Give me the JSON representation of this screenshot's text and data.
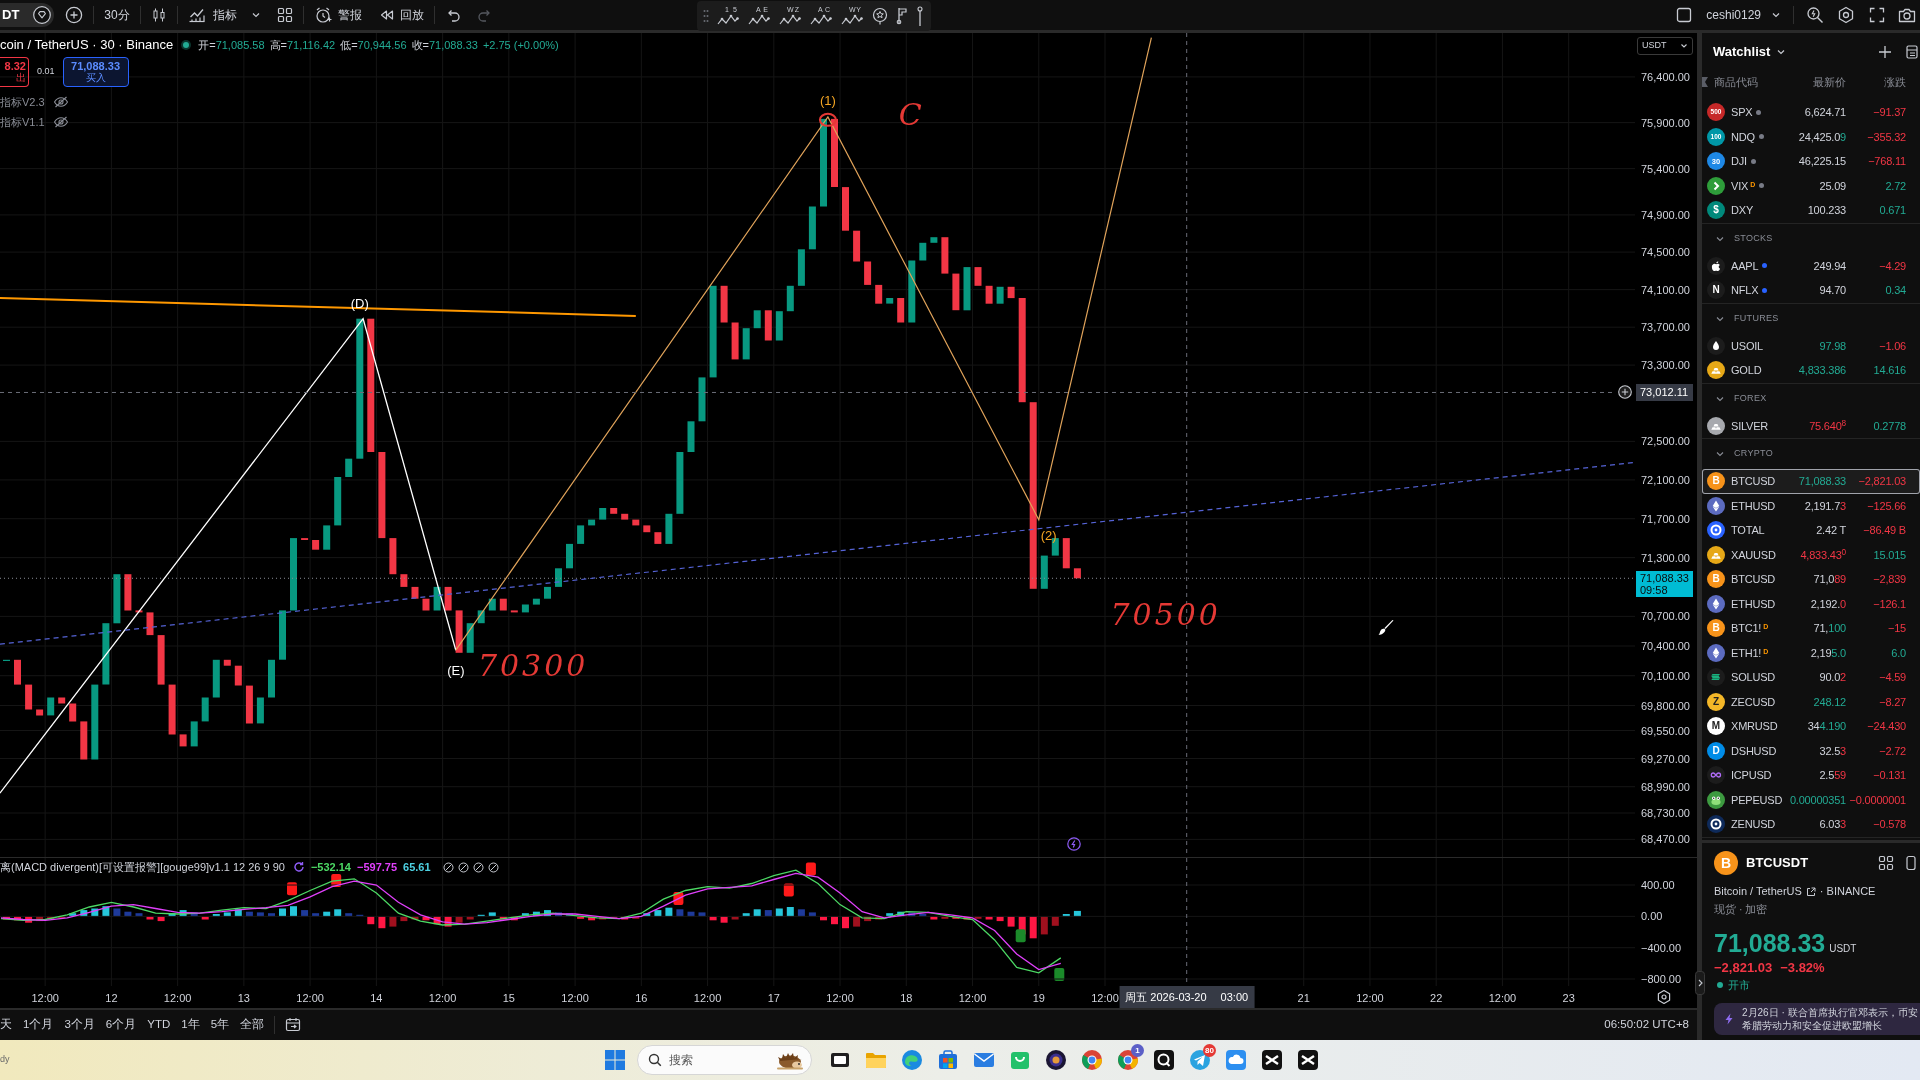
{
  "toolbar": {
    "symbol": "DT",
    "interval": "30分",
    "indicators": "指标",
    "alerts": "警报",
    "replay": "回放",
    "wave_tools": [
      {
        "marks": [
          "1",
          "5"
        ]
      },
      {
        "marks": [
          "A",
          "E"
        ]
      },
      {
        "marks": [
          "W",
          "Z"
        ]
      },
      {
        "marks": [
          "A",
          "C"
        ]
      },
      {
        "marks": [
          "W",
          "Y"
        ]
      }
    ],
    "user": "ceshi0129"
  },
  "legend": {
    "title": "coin / TetherUS · 30 · Binance",
    "market_open": true,
    "ohlc": [
      {
        "label": "开=",
        "value": "71,085.58"
      },
      {
        "label": "高=",
        "value": "71,116.42"
      },
      {
        "label": "低=",
        "value": "70,944.56"
      },
      {
        "label": "收=",
        "value": "71,088.33"
      }
    ],
    "change": "+2.75 (+0.00%)"
  },
  "order_panel": {
    "sell_price": "8.32",
    "sell_label": "出",
    "spread": "0.01",
    "buy_price": "71,088.33",
    "buy_label": "买入"
  },
  "indicators": [
    {
      "name": "指标V2.3",
      "hidden": true
    },
    {
      "name": "指标V1.1",
      "hidden": true
    }
  ],
  "chart": {
    "wave_labels": [
      {
        "text": "(1)",
        "color": "#f5a623"
      },
      {
        "text": "(D)",
        "color": "#ffffff"
      },
      {
        "text": "(E)",
        "color": "#ffffff"
      },
      {
        "text": "(2)",
        "color": "#f5a623"
      }
    ],
    "notes": [
      {
        "text": "C"
      },
      {
        "text": "70300"
      },
      {
        "text": "70500"
      }
    ]
  },
  "price_axis": {
    "currency": "USDT",
    "labels": [
      "76,400.00",
      "75,900.00",
      "75,400.00",
      "74,900.00",
      "74,500.00",
      "74,100.00",
      "73,700.00",
      "73,300.00",
      "72,500.00",
      "72,100.00",
      "71,700.00",
      "71,300.00",
      "70,700.00",
      "70,400.00",
      "70,100.00",
      "69,800.00",
      "69,550.00",
      "69,270.00",
      "68,990.00",
      "68,730.00",
      "68,470.00"
    ],
    "crosshair_price": "73,012.11",
    "last_price": "71,088.33",
    "countdown": "09:58"
  },
  "macd": {
    "title": "离(MACD divergent)[可设置报警][gouge99]v1.1 12 26 9 90",
    "values": [
      {
        "text": "−532.14",
        "color": "#4cd964"
      },
      {
        "text": "−597.75",
        "color": "#e040fb"
      },
      {
        "text": "65.61",
        "color": "#4dd0e1"
      }
    ],
    "chart_data": {
      "type": "line",
      "categories": [
        null,
        null,
        "12:00",
        null,
        null,
        "12",
        null,
        null,
        "12:00",
        null,
        null,
        "13",
        null,
        null,
        "12:00",
        null,
        null,
        "14",
        null,
        null,
        "12:00",
        null,
        null,
        "15",
        null,
        null,
        "12:00",
        null,
        null,
        "16",
        null,
        null,
        "12:00",
        null,
        null,
        "17",
        null,
        null,
        "12:00",
        null,
        null,
        "18",
        null,
        null,
        "12:00",
        null,
        null,
        "19",
        null,
        null,
        "12:00",
        null,
        null,
        null,
        null,
        null,
        null,
        null,
        null,
        "21",
        null,
        null,
        "12:00",
        null,
        null,
        "22",
        null,
        null,
        "12:00",
        null,
        null,
        "23"
      ],
      "series": [
        {
          "color": "#4cd964",
          "values": [
            -30,
            -50,
            -40,
            20,
            120,
            180,
            120,
            40,
            30,
            40,
            80,
            110,
            100,
            200,
            330,
            450,
            480,
            300,
            40,
            -60,
            -110,
            -100,
            -60,
            -20,
            20,
            40,
            10,
            -20,
            -30,
            40,
            220,
            330,
            380,
            360,
            420,
            520,
            590,
            420,
            150,
            -20,
            -30,
            60,
            50,
            0,
            -40,
            -300,
            -650,
            -720,
            -530,
            null,
            null,
            null,
            null,
            null,
            null,
            null,
            null,
            null,
            null,
            null,
            null,
            null,
            null,
            null,
            null,
            null,
            null,
            null,
            null,
            null,
            null,
            null
          ]
        },
        {
          "color": "#e040fb",
          "values": [
            -20,
            -40,
            -50,
            -20,
            50,
            130,
            150,
            100,
            50,
            40,
            60,
            90,
            110,
            140,
            250,
            380,
            450,
            400,
            180,
            20,
            -70,
            -100,
            -80,
            -40,
            0,
            30,
            30,
            0,
            -30,
            0,
            130,
            270,
            350,
            370,
            390,
            470,
            550,
            500,
            300,
            60,
            -20,
            20,
            50,
            20,
            -20,
            -180,
            -480,
            -680,
            -600,
            null,
            null,
            null,
            null,
            null,
            null,
            null,
            null,
            null,
            null,
            null,
            null,
            null,
            null,
            null,
            null,
            null,
            null,
            null,
            null,
            null,
            null,
            null
          ]
        }
      ],
      "ylim": [
        -889,
        745
      ],
      "yticks": [
        {
          "value": 400,
          "label": "400.00"
        },
        {
          "value": 0,
          "label": "0.00"
        },
        {
          "value": -400,
          "label": "−400.00"
        },
        {
          "value": -800,
          "label": "−800.00"
        }
      ],
      "grid": true
    }
  },
  "time_axis": {
    "crosshair_date": "周五 2026-03-20",
    "crosshair_time": "03:00"
  },
  "bottom_bar": {
    "ranges": [
      "天",
      "1个月",
      "3个月",
      "6个月",
      "YTD",
      "1年",
      "5年",
      "全部"
    ],
    "clock": "06:50:02 UTC+8"
  },
  "watchlist": {
    "title": "Watchlist",
    "columns": [
      "商品代码",
      "最新价",
      "涨跌"
    ],
    "groups": [
      {
        "items": [
          {
            "symbol": "SPX",
            "logo": {
              "kind": "text",
              "text": "500",
              "color": "#c62828"
            },
            "color": "#787b86",
            "last": [
              {
                "text": "6,624.71",
                "kind": "flat"
              }
            ],
            "change": [
              {
                "text": "−91.37",
                "kind": "down"
              }
            ],
            "selected": false
          },
          {
            "symbol": "NDQ",
            "logo": {
              "kind": "text",
              "text": "100",
              "color": "#0097a7"
            },
            "color": "#787b86",
            "last": [
              {
                "text": "24,425.0",
                "kind": "flat"
              },
              {
                "text": "9",
                "kind": "up"
              }
            ],
            "change": [
              {
                "text": "−355.32",
                "kind": "down"
              }
            ],
            "selected": false
          },
          {
            "symbol": "DJI",
            "logo": {
              "kind": "text",
              "text": "30",
              "color": "#1e88e5"
            },
            "color": "#787b86",
            "last": [
              {
                "text": "46,225.15",
                "kind": "flat"
              }
            ],
            "change": [
              {
                "text": "−768.11",
                "kind": "down"
              }
            ],
            "selected": false
          },
          {
            "symbol": "VIX",
            "flag": "D",
            "logo": {
              "kind": "chevron",
              "color": "#2e9d3a"
            },
            "color": "#787b86",
            "last": [
              {
                "text": "25.09",
                "kind": "flat"
              }
            ],
            "change": [
              {
                "text": "2.72",
                "kind": "up"
              }
            ],
            "selected": false
          },
          {
            "symbol": "DXY",
            "logo": {
              "kind": "text",
              "text": "$",
              "color": "#00897b"
            },
            "last": [
              {
                "text": "100.233",
                "kind": "flat"
              }
            ],
            "change": [
              {
                "text": "0.671",
                "kind": "up"
              }
            ],
            "selected": false
          }
        ]
      },
      {
        "title": "STOCKS",
        "expanded": true,
        "items": [
          {
            "symbol": "AAPL",
            "logo": {
              "kind": "apple",
              "color": "#1c1c1c"
            },
            "color": "#2962ff",
            "last": [
              {
                "text": "249.94",
                "kind": "flat"
              }
            ],
            "change": [
              {
                "text": "−4.29",
                "kind": "down"
              }
            ],
            "selected": false
          },
          {
            "symbol": "NFLX",
            "logo": {
              "kind": "text",
              "text": "N",
              "color": "#1c1c1c"
            },
            "color": "#2962ff",
            "last": [
              {
                "text": "94.70",
                "kind": "flat"
              }
            ],
            "change": [
              {
                "text": "0.34",
                "kind": "up"
              }
            ],
            "selected": false
          }
        ]
      },
      {
        "title": "FUTURES",
        "expanded": true,
        "items": [
          {
            "symbol": "USOIL",
            "logo": {
              "kind": "drop",
              "color": "#1c1c1c"
            },
            "last": [
              {
                "text": "97.98",
                "kind": "up"
              }
            ],
            "change": [
              {
                "text": "−1.06",
                "kind": "down"
              }
            ],
            "selected": false
          },
          {
            "symbol": "GOLD",
            "logo": {
              "kind": "bars",
              "color": "#e6a817"
            },
            "last": [
              {
                "text": "4,833.386",
                "kind": "up"
              }
            ],
            "change": [
              {
                "text": "14.616",
                "kind": "up"
              }
            ],
            "selected": false
          }
        ]
      },
      {
        "title": "FOREX",
        "expanded": true,
        "items": [
          {
            "symbol": "SILVER",
            "logo": {
              "kind": "bars",
              "color": "#a7a9ae"
            },
            "last": [
              {
                "text": "75.640$^{8}$",
                "kind": "down"
              }
            ],
            "change": [
              {
                "text": "0.2778",
                "kind": "up"
              }
            ],
            "selected": false
          }
        ]
      },
      {
        "title": "CRYPTO",
        "expanded": true,
        "items": [
          {
            "symbol": "BTCUSD",
            "logo": {
              "kind": "text",
              "text": "B",
              "color": "#f7931a"
            },
            "last": [
              {
                "text": "71,088.33",
                "kind": "up"
              }
            ],
            "change": [
              {
                "text": "−2,821.03",
                "kind": "down"
              }
            ],
            "selected": true
          },
          {
            "symbol": "ETHUSD",
            "logo": {
              "kind": "diamond",
              "color": "#5c6bc0"
            },
            "last": [
              {
                "text": "2,191.7",
                "kind": "flat"
              },
              {
                "text": "3",
                "kind": "down"
              }
            ],
            "change": [
              {
                "text": "−125.66",
                "kind": "down"
              }
            ],
            "selected": false
          },
          {
            "symbol": "TOTAL",
            "logo": {
              "kind": "ring",
              "color": "#2962ff"
            },
            "last": [
              {
                "text": "2.42 T",
                "kind": "flat"
              }
            ],
            "change": [
              {
                "text": "−86.49 B",
                "kind": "down"
              }
            ],
            "selected": false
          },
          {
            "symbol": "XAUUSD",
            "logo": {
              "kind": "bars",
              "color": "#e6a817"
            },
            "last": [
              {
                "text": "4,833.43$^{0}$",
                "kind": "down"
              }
            ],
            "change": [
              {
                "text": "15.015",
                "kind": "up"
              }
            ],
            "selected": false
          },
          {
            "symbol": "BTCUSD",
            "logo": {
              "kind": "text",
              "text": "B",
              "color": "#f7931a"
            },
            "last": [
              {
                "text": "71,0",
                "kind": "flat"
              },
              {
                "text": "89",
                "kind": "down"
              }
            ],
            "change": [
              {
                "text": "−2,839",
                "kind": "down"
              }
            ],
            "selected": false
          },
          {
            "symbol": "ETHUSD",
            "logo": {
              "kind": "diamond",
              "color": "#5c6bc0"
            },
            "last": [
              {
                "text": "2,192.",
                "kind": "flat"
              },
              {
                "text": "0",
                "kind": "down"
              }
            ],
            "change": [
              {
                "text": "−126.1",
                "kind": "down"
              }
            ],
            "selected": false
          },
          {
            "symbol": "BTC1!",
            "flag": "D",
            "logo": {
              "kind": "text",
              "text": "B",
              "color": "#f7931a"
            },
            "last": [
              {
                "text": "71,",
                "kind": "flat"
              },
              {
                "text": "100",
                "kind": "up"
              }
            ],
            "change": [
              {
                "text": "−15",
                "kind": "down"
              }
            ],
            "selected": false
          },
          {
            "symbol": "ETH1!",
            "flag": "D",
            "logo": {
              "kind": "diamond",
              "color": "#5c6bc0"
            },
            "last": [
              {
                "text": "2,19",
                "kind": "flat"
              },
              {
                "text": "5.0",
                "kind": "up"
              }
            ],
            "change": [
              {
                "text": "6.0",
                "kind": "up"
              }
            ],
            "selected": false
          },
          {
            "symbol": "SOLUSD",
            "logo": {
              "kind": "stripes",
              "color": "#1c1c1c"
            },
            "last": [
              {
                "text": "90.0",
                "kind": "flat"
              },
              {
                "text": "2",
                "kind": "down"
              }
            ],
            "change": [
              {
                "text": "−4.59",
                "kind": "down"
              }
            ],
            "selected": false
          },
          {
            "symbol": "ZECUSD",
            "logo": {
              "kind": "text",
              "text": "Z",
              "color": "#f4b728"
            },
            "last": [
              {
                "text": "248.12",
                "kind": "up"
              }
            ],
            "change": [
              {
                "text": "−8.27",
                "kind": "down"
              }
            ],
            "selected": false
          },
          {
            "symbol": "XMRUSD",
            "logo": {
              "kind": "text",
              "text": "M",
              "color": "#ffffff"
            },
            "last": [
              {
                "text": "34",
                "kind": "flat"
              },
              {
                "text": "4.190",
                "kind": "up"
              }
            ],
            "change": [
              {
                "text": "−24.430",
                "kind": "down"
              }
            ],
            "selected": false
          },
          {
            "symbol": "DSHUSD",
            "logo": {
              "kind": "text",
              "text": "D",
              "color": "#008ce7"
            },
            "last": [
              {
                "text": "32.5",
                "kind": "flat"
              },
              {
                "text": "3",
                "kind": "down"
              }
            ],
            "change": [
              {
                "text": "−2.72",
                "kind": "down"
              }
            ],
            "selected": false
          },
          {
            "symbol": "ICPUSD",
            "logo": {
              "kind": "infinity",
              "color": "#1c1c1c"
            },
            "last": [
              {
                "text": "2.5",
                "kind": "flat"
              },
              {
                "text": "59",
                "kind": "down"
              }
            ],
            "change": [
              {
                "text": "−0.131",
                "kind": "down"
              }
            ],
            "selected": false
          },
          {
            "symbol": "PEPEUSD",
            "logo": {
              "kind": "frog",
              "color": "#3d9a40"
            },
            "last": [
              {
                "text": "0.00000351",
                "kind": "up"
              }
            ],
            "change": [
              {
                "text": "−0.0000001",
                "kind": "down"
              }
            ],
            "selected": false
          },
          {
            "symbol": "ZENUSD",
            "logo": {
              "kind": "ring",
              "color": "#0e2a5a"
            },
            "last": [
              {
                "text": "6.03",
                "kind": "flat"
              },
              {
                "text": "3",
                "kind": "down"
              }
            ],
            "change": [
              {
                "text": "−0.578",
                "kind": "down"
              }
            ],
            "selected": false
          }
        ]
      }
    ]
  },
  "details": {
    "symbol": "BTCUSDT",
    "logo": {
      "kind": "text",
      "text": "B",
      "color": "#f7931a"
    },
    "name": "Bitcoin / TetherUS",
    "exchange": "· BINANCE",
    "tags": "现货 · 加密",
    "price": "71,088.33",
    "currency": "USDT",
    "change": "−2,821.03",
    "change_pct": "−3.82%",
    "status": "开市",
    "open": true,
    "news": [
      "2月26日 · 联合首席执行官邓表示，币安",
      "希腊劳动力和安全促进欧盟增长"
    ]
  },
  "taskbar": {
    "status_text": "dy",
    "search": {
      "placeholder": "搜索"
    },
    "apps": [
      {
        "kind": "taskview"
      },
      {
        "kind": "folder"
      },
      {
        "kind": "swirl"
      },
      {
        "kind": "store"
      },
      {
        "kind": "mail"
      },
      {
        "kind": "bag"
      },
      {
        "kind": "orb"
      },
      {
        "kind": "browser"
      },
      {
        "kind": "browser",
        "badge": {
          "text": "1",
          "color": "#5b5fc7"
        }
      },
      {
        "kind": "tail"
      },
      {
        "kind": "plane",
        "badge": {
          "text": "80",
          "color": "#e53935"
        }
      },
      {
        "kind": "cloud"
      },
      {
        "kind": "cross"
      },
      {
        "kind": "cross"
      }
    ]
  }
}
